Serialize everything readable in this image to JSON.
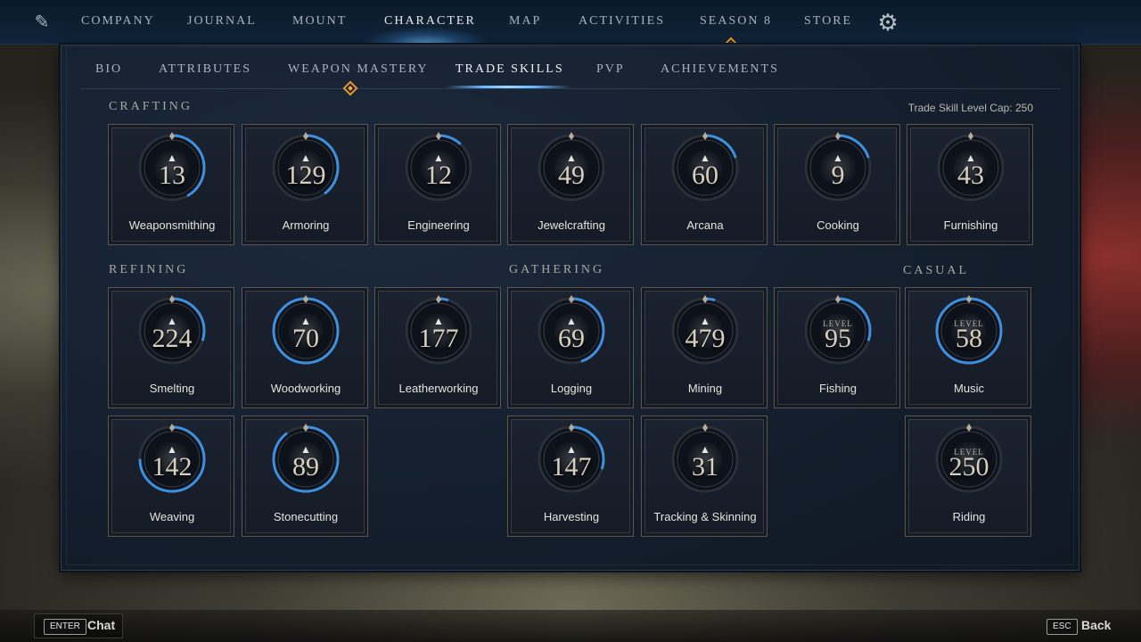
{
  "top_nav": {
    "items": [
      {
        "label": "COMPANY",
        "active": false
      },
      {
        "label": "JOURNAL",
        "active": false
      },
      {
        "label": "MOUNT",
        "active": false
      },
      {
        "label": "CHARACTER",
        "active": true
      },
      {
        "label": "MAP",
        "active": false
      },
      {
        "label": "ACTIVITIES",
        "active": false
      },
      {
        "label": "SEASON 8",
        "active": false
      },
      {
        "label": "STORE",
        "active": false
      }
    ],
    "settings_icon": "gear-icon",
    "logo_icon": "profile-icon"
  },
  "sub_nav": {
    "items": [
      {
        "label": "BIO",
        "active": false
      },
      {
        "label": "ATTRIBUTES",
        "active": false
      },
      {
        "label": "WEAPON MASTERY",
        "active": false
      },
      {
        "label": "TRADE SKILLS",
        "active": true
      },
      {
        "label": "PVP",
        "active": false
      },
      {
        "label": "ACHIEVEMENTS",
        "active": false
      }
    ]
  },
  "level_cap": "Trade Skill Level Cap: 250",
  "sections": {
    "crafting": "CRAFTING",
    "refining": "REFINING",
    "gathering": "GATHERING",
    "casual": "CASUAL"
  },
  "skills": [
    {
      "name": "Weaponsmithing",
      "level": "13",
      "progress": 0.42
    },
    {
      "name": "Armoring",
      "level": "129",
      "progress": 0.4
    },
    {
      "name": "Engineering",
      "level": "12",
      "progress": 0.12
    },
    {
      "name": "Jewelcrafting",
      "level": "49",
      "progress": 0.0
    },
    {
      "name": "Arcana",
      "level": "60",
      "progress": 0.2
    },
    {
      "name": "Cooking",
      "level": "9",
      "progress": 0.2
    },
    {
      "name": "Furnishing",
      "level": "43",
      "progress": 0.0
    },
    {
      "name": "Smelting",
      "level": "224",
      "progress": 0.3
    },
    {
      "name": "Woodworking",
      "level": "70",
      "progress": 1.0
    },
    {
      "name": "Leatherworking",
      "level": "177",
      "progress": 0.05
    },
    {
      "name": "Logging",
      "level": "69",
      "progress": 0.45
    },
    {
      "name": "Mining",
      "level": "479",
      "progress": 0.05
    },
    {
      "name": "Fishing",
      "level": "95",
      "level_word": "LEVEL",
      "progress": 0.3
    },
    {
      "name": "Music",
      "level": "58",
      "level_word": "LEVEL",
      "progress": 1.0
    },
    {
      "name": "Weaving",
      "level": "142",
      "progress": 0.75
    },
    {
      "name": "Stonecutting",
      "level": "89",
      "progress": 0.9
    },
    {
      "name": "Harvesting",
      "level": "147",
      "progress": 0.3
    },
    {
      "name": "Tracking & Skinning",
      "level": "31",
      "progress": 0.0
    },
    {
      "name": "Riding",
      "level": "250",
      "level_word": "LEVEL",
      "progress": 0.0
    }
  ],
  "bottom_bar": {
    "chat_key": "ENTER",
    "chat_label": "Chat",
    "back_key": "ESC",
    "back_label": "Back"
  },
  "colors": {
    "progress_ring": "#3d8fe0",
    "notification_diamond": "#e09a3a"
  }
}
